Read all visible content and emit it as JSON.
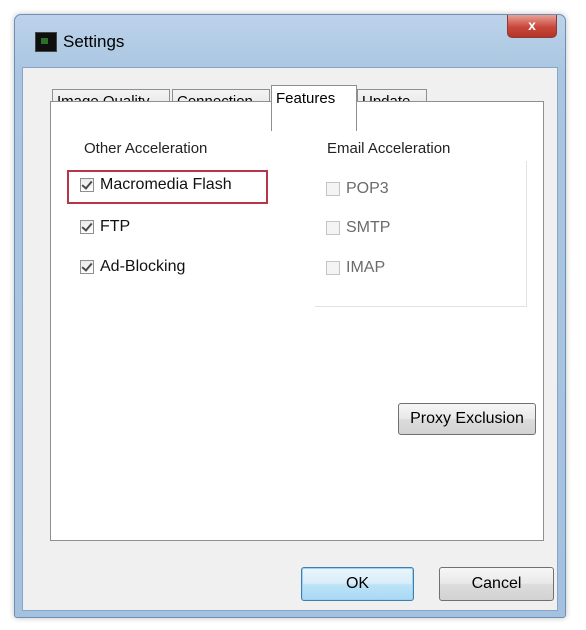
{
  "window": {
    "title": "Settings",
    "close_label": "x"
  },
  "tabs": [
    {
      "label": "Image Quality",
      "active": false
    },
    {
      "label": "Connection",
      "active": false
    },
    {
      "label": "Features",
      "active": true
    },
    {
      "label": "Update",
      "active": false
    }
  ],
  "other_acceleration": {
    "label": "Other Acceleration",
    "items": [
      {
        "label": "Macromedia Flash",
        "checked": true,
        "highlighted": true
      },
      {
        "label": "FTP",
        "checked": true
      },
      {
        "label": "Ad-Blocking",
        "checked": true
      }
    ]
  },
  "email_acceleration": {
    "label": "Email Acceleration",
    "items": [
      {
        "label": "POP3",
        "checked": false,
        "enabled": false
      },
      {
        "label": "SMTP",
        "checked": false,
        "enabled": false
      },
      {
        "label": "IMAP",
        "checked": false,
        "enabled": false
      }
    ]
  },
  "buttons": {
    "proxy_exclusion": "Proxy Exclusion",
    "ok": "OK",
    "cancel": "Cancel"
  },
  "colors": {
    "highlight": "#b8344a",
    "title_bar": "#a9c5e1",
    "close_button": "#c8473a"
  }
}
